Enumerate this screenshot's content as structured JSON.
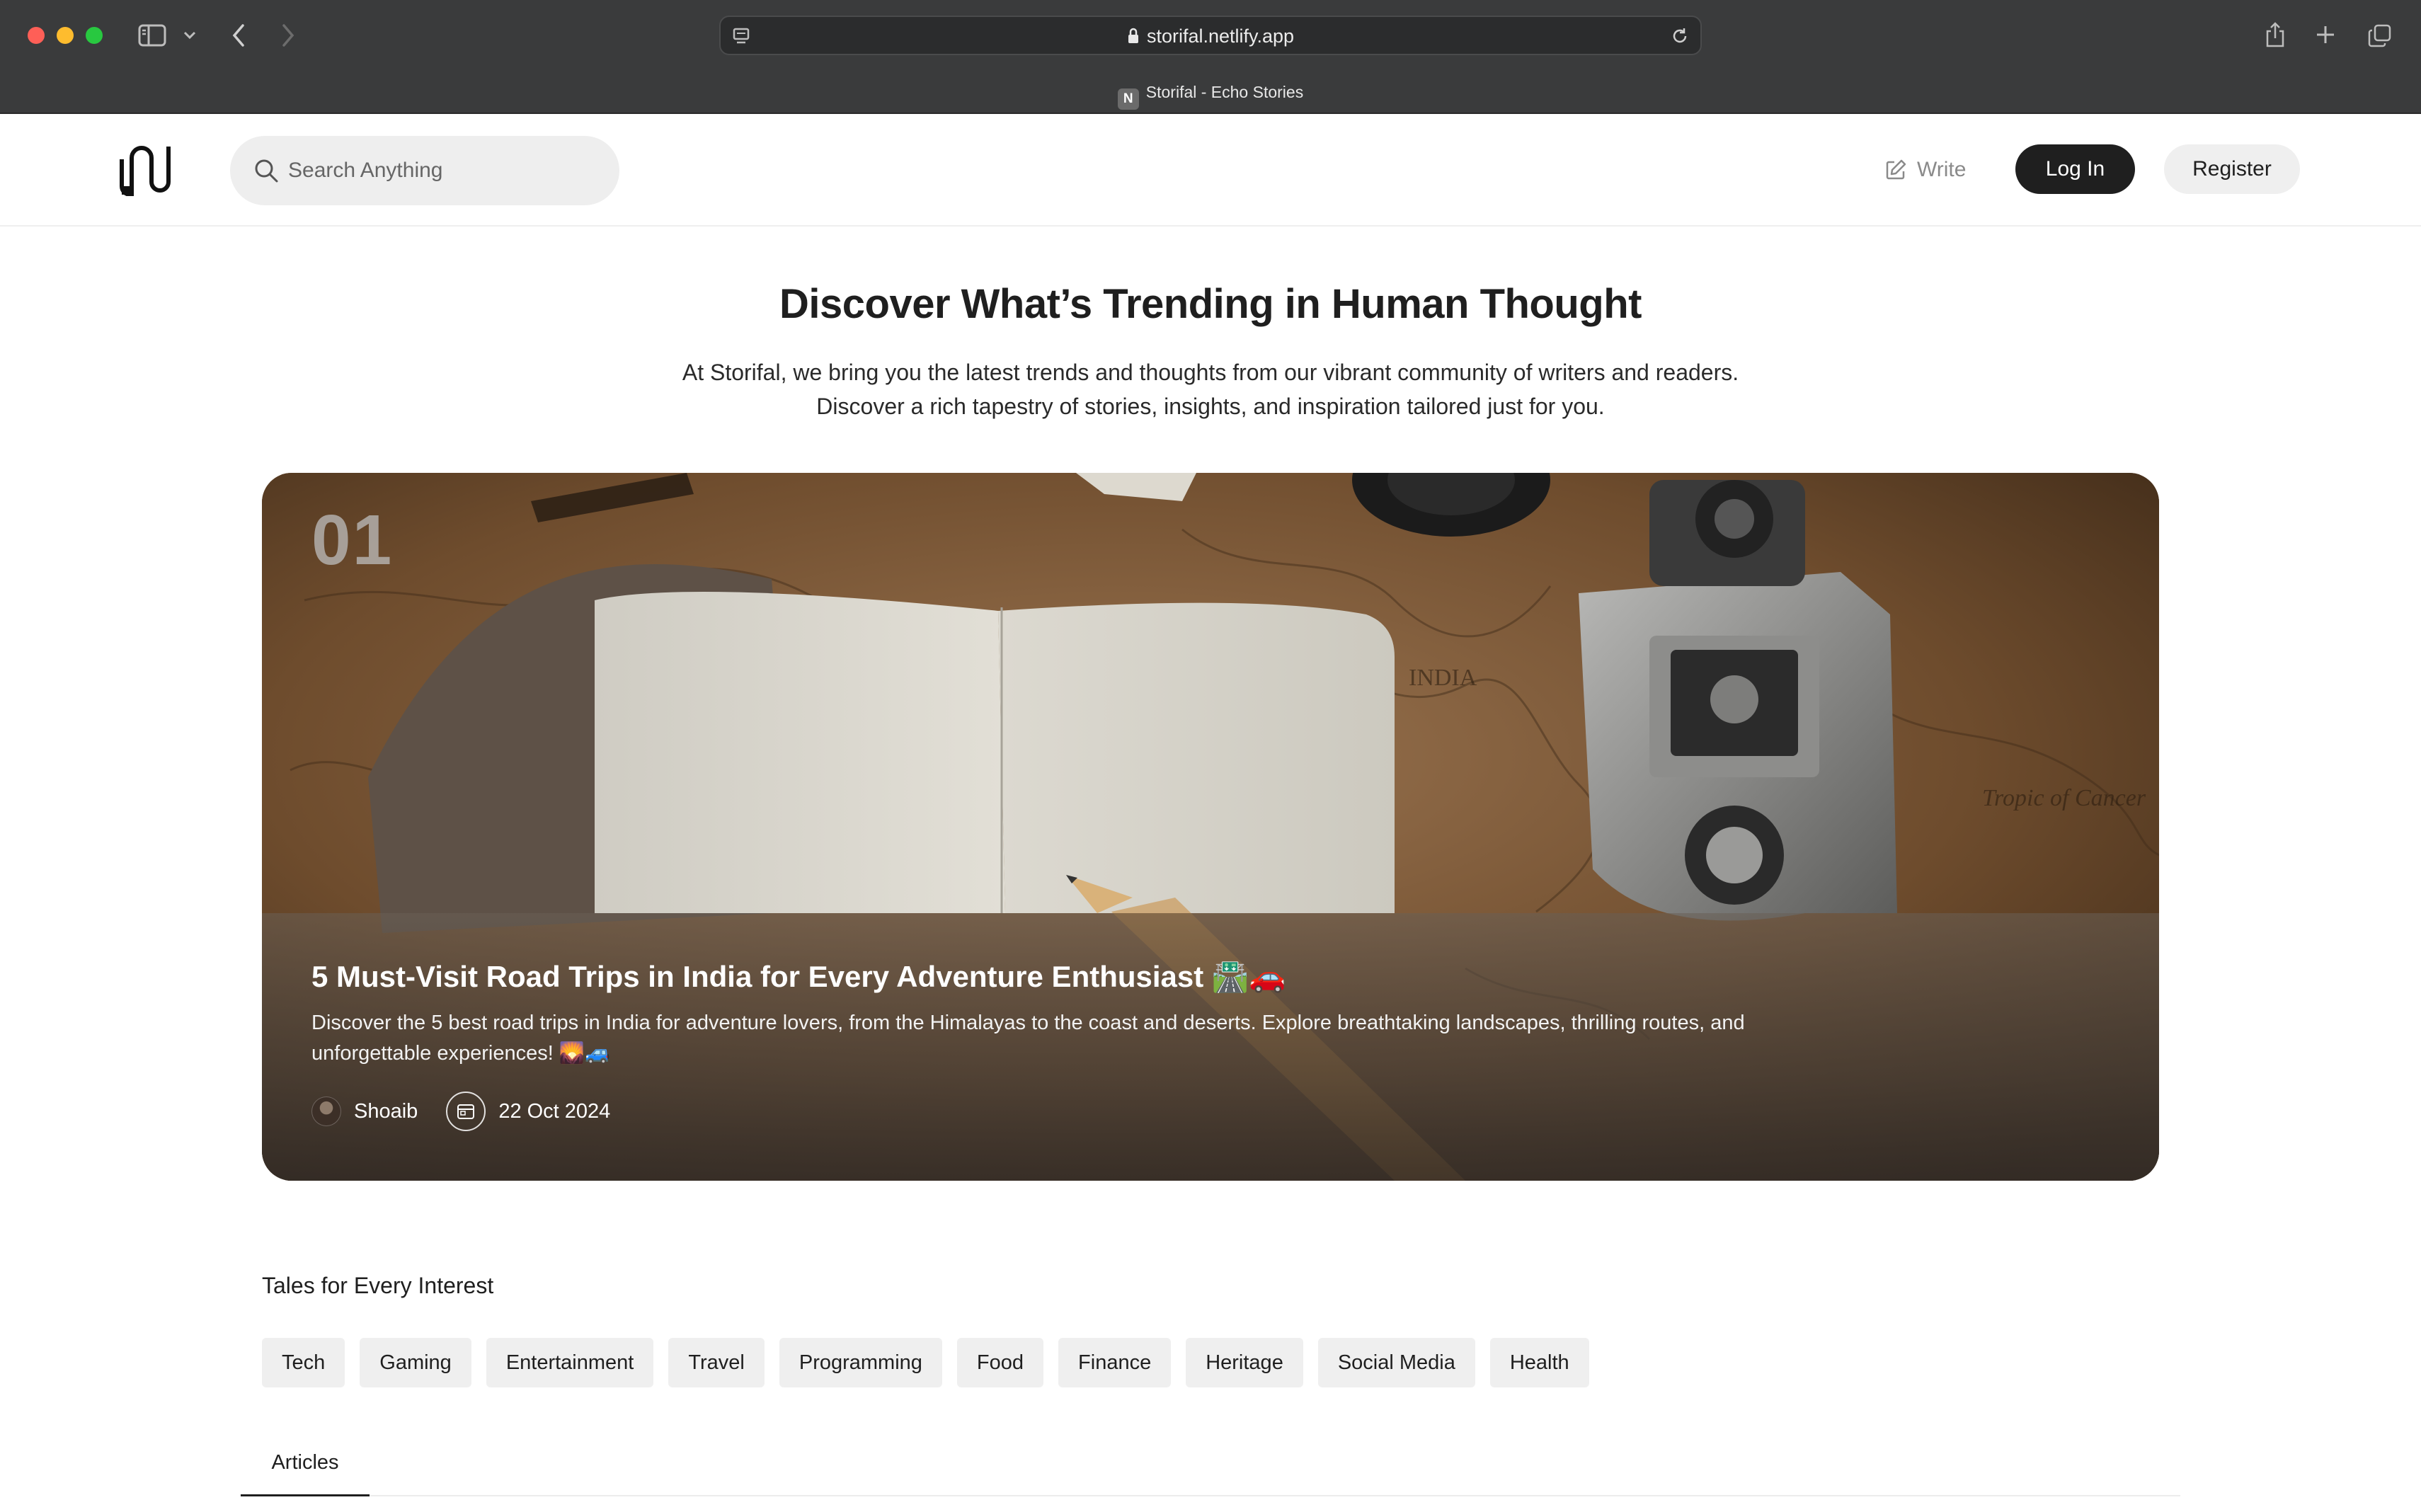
{
  "browser": {
    "url": "storifal.netlify.app",
    "tab_title": "Storifal - Echo Stories",
    "favicon_letter": "N"
  },
  "header": {
    "search_placeholder": "Search Anything",
    "write_label": "Write",
    "login_label": "Log In",
    "register_label": "Register"
  },
  "hero": {
    "title": "Discover What’s Trending in Human Thought",
    "subtitle_line1": "At Storifal, we bring you the latest trends and thoughts from our vibrant community of writers and readers.",
    "subtitle_line2": "Discover a rich tapestry of stories, insights, and inspiration tailored just for you."
  },
  "featured": {
    "rank": "01",
    "title": "5 Must-Visit Road Trips in India for Every Adventure Enthusiast 🛣️🚗",
    "description": "Discover the 5 best road trips in India for adventure lovers, from the Himalayas to the coast and deserts. Explore breathtaking landscapes, thrilling routes, and unforgettable experiences! 🌄🚙",
    "author": "Shoaib",
    "date": "22 Oct 2024"
  },
  "categories": {
    "heading": "Tales for Every Interest",
    "items": [
      "Tech",
      "Gaming",
      "Entertainment",
      "Travel",
      "Programming",
      "Food",
      "Finance",
      "Heritage",
      "Social Media",
      "Health"
    ]
  },
  "tabs": {
    "articles_label": "Articles"
  },
  "colors": {
    "primary_button": "#1f1f1f",
    "chip_background": "#efefef",
    "chrome_background": "#3a3b3c"
  }
}
